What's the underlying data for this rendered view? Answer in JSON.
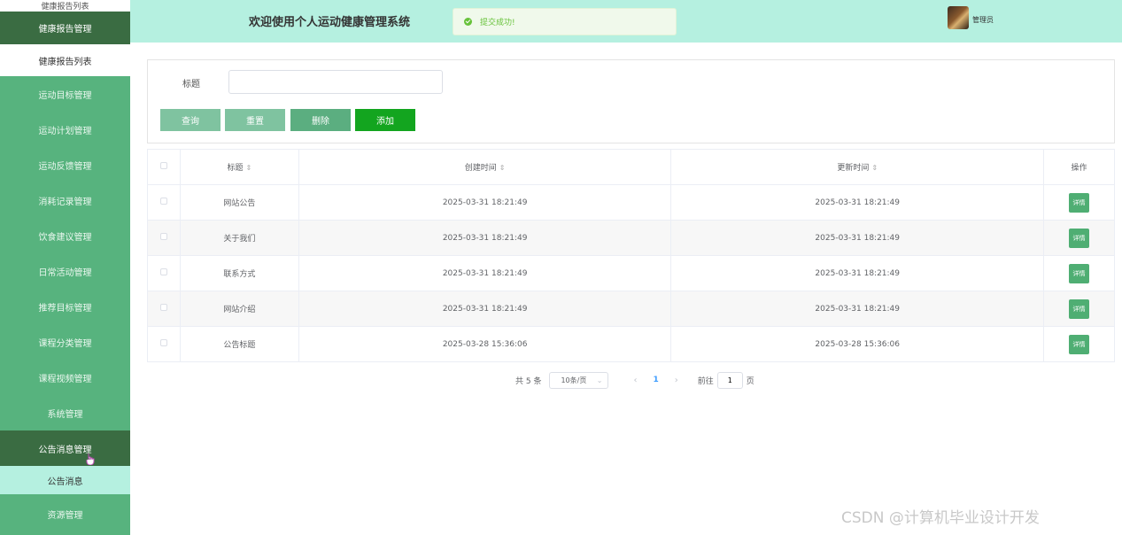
{
  "sidebar": {
    "items": [
      {
        "label": "健康报告列表",
        "style": "top"
      },
      {
        "label": "健康报告管理",
        "style": "dark first-dark"
      },
      {
        "label": "健康报告列表",
        "style": "white sub1"
      },
      {
        "label": "运动目标管理",
        "style": ""
      },
      {
        "label": "运动计划管理",
        "style": ""
      },
      {
        "label": "运动反馈管理",
        "style": ""
      },
      {
        "label": "消耗记录管理",
        "style": ""
      },
      {
        "label": "饮食建议管理",
        "style": ""
      },
      {
        "label": "日常活动管理",
        "style": ""
      },
      {
        "label": "推荐目标管理",
        "style": ""
      },
      {
        "label": "课程分类管理",
        "style": ""
      },
      {
        "label": "课程视频管理",
        "style": ""
      },
      {
        "label": "系统管理",
        "style": ""
      },
      {
        "label": "公告消息管理",
        "style": "dark"
      },
      {
        "label": "公告消息",
        "style": "light sub2"
      },
      {
        "label": "资源管理",
        "style": "last"
      }
    ]
  },
  "header": {
    "title": "欢迎使用个人运动健康管理系统",
    "toast": "提交成功!",
    "username": "管理员"
  },
  "search": {
    "label": "标题",
    "value": "",
    "buttons": {
      "query": "查询",
      "reset": "重置",
      "delete": "删除",
      "add": "添加"
    }
  },
  "table": {
    "headers": {
      "title": "标题",
      "created": "创建时间",
      "updated": "更新时间",
      "op": "操作"
    },
    "rows": [
      {
        "title": "网站公告",
        "created": "2025-03-31 18:21:49",
        "updated": "2025-03-31 18:21:49",
        "action": "详情"
      },
      {
        "title": "关于我们",
        "created": "2025-03-31 18:21:49",
        "updated": "2025-03-31 18:21:49",
        "action": "详情"
      },
      {
        "title": "联系方式",
        "created": "2025-03-31 18:21:49",
        "updated": "2025-03-31 18:21:49",
        "action": "详情"
      },
      {
        "title": "网站介绍",
        "created": "2025-03-31 18:21:49",
        "updated": "2025-03-31 18:21:49",
        "action": "详情"
      },
      {
        "title": "公告标题",
        "created": "2025-03-28 15:36:06",
        "updated": "2025-03-28 15:36:06",
        "action": "详情"
      }
    ]
  },
  "pager": {
    "total": "共 5 条",
    "page_size": "10条/页",
    "current": "1",
    "goto_prefix": "前往",
    "goto_value": "1",
    "goto_suffix": "页"
  },
  "watermark": "CSDN @计算机毕业设计开发",
  "colors": {
    "sidebar": "#57b37e",
    "sidebar_active": "#3a6c42",
    "header": "#b5f0e0",
    "add_button": "#13a51f"
  }
}
